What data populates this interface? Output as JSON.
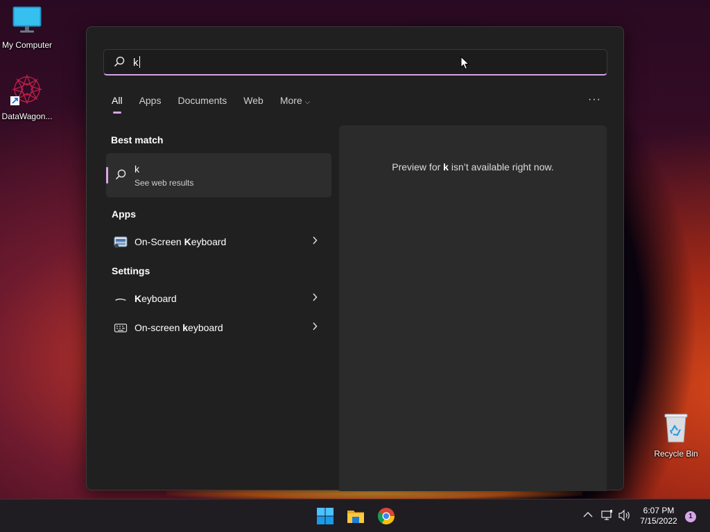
{
  "desktop": {
    "icons": [
      {
        "label": "My Computer"
      },
      {
        "label": "DataWagon..."
      },
      {
        "label": "Recycle Bin"
      }
    ]
  },
  "search": {
    "query": "k",
    "tabs": [
      {
        "label": "All"
      },
      {
        "label": "Apps"
      },
      {
        "label": "Documents"
      },
      {
        "label": "Web"
      },
      {
        "label": "More"
      }
    ],
    "more_options": "···",
    "best_match": {
      "title": "Best match",
      "item_title": "k",
      "item_subtitle": "See web results"
    },
    "apps": {
      "title": "Apps",
      "items": [
        {
          "pre": "On-Screen ",
          "bold": "K",
          "post": "eyboard"
        }
      ]
    },
    "settings": {
      "title": "Settings",
      "items": [
        {
          "pre": "",
          "bold": "K",
          "post": "eyboard"
        },
        {
          "pre": "On-screen ",
          "bold": "k",
          "post": "eyboard"
        }
      ]
    },
    "preview": {
      "pre": "Preview for ",
      "bold": "k",
      "post": " isn’t available right now."
    }
  },
  "taskbar": {
    "time": "6:07 PM",
    "date": "7/15/2022",
    "notification_count": "1"
  },
  "colors": {
    "accent": "#d6a6e8",
    "panel_bg": "#202020",
    "preview_bg": "#2b2b2b"
  }
}
